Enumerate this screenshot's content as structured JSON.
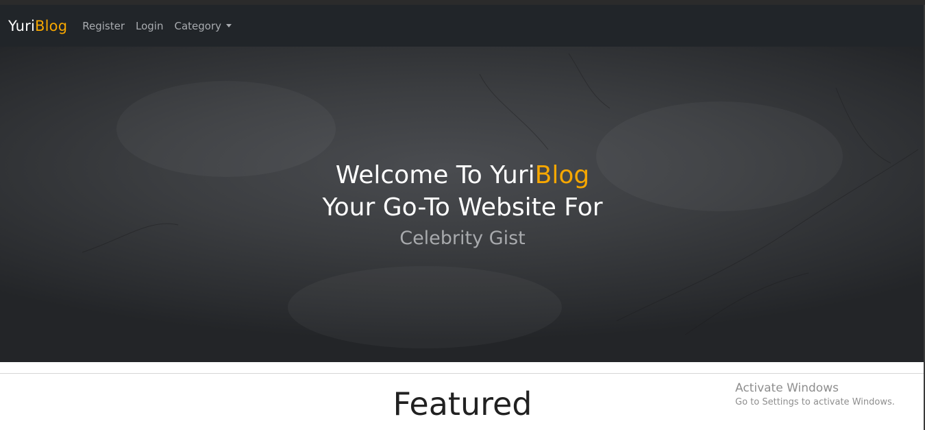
{
  "navbar": {
    "brand_part1": "Yuri",
    "brand_part2": "Blog",
    "items": [
      {
        "label": "Register"
      },
      {
        "label": "Login"
      },
      {
        "label": "Category"
      }
    ]
  },
  "hero": {
    "line1_prefix": "Welcome To Yuri",
    "line1_accent": "Blog",
    "line2": "Your Go-To Website For",
    "line3": "Celebrity Gist"
  },
  "featured": {
    "title": "Featured"
  },
  "watermark": {
    "title": "Activate Windows",
    "subtitle": "Go to Settings to activate Windows."
  },
  "colors": {
    "accent": "#f7a700",
    "navbar_bg": "#212529",
    "nav_text": "#a9acb0"
  },
  "icons": {
    "category_dropdown": "caret-down-icon"
  }
}
